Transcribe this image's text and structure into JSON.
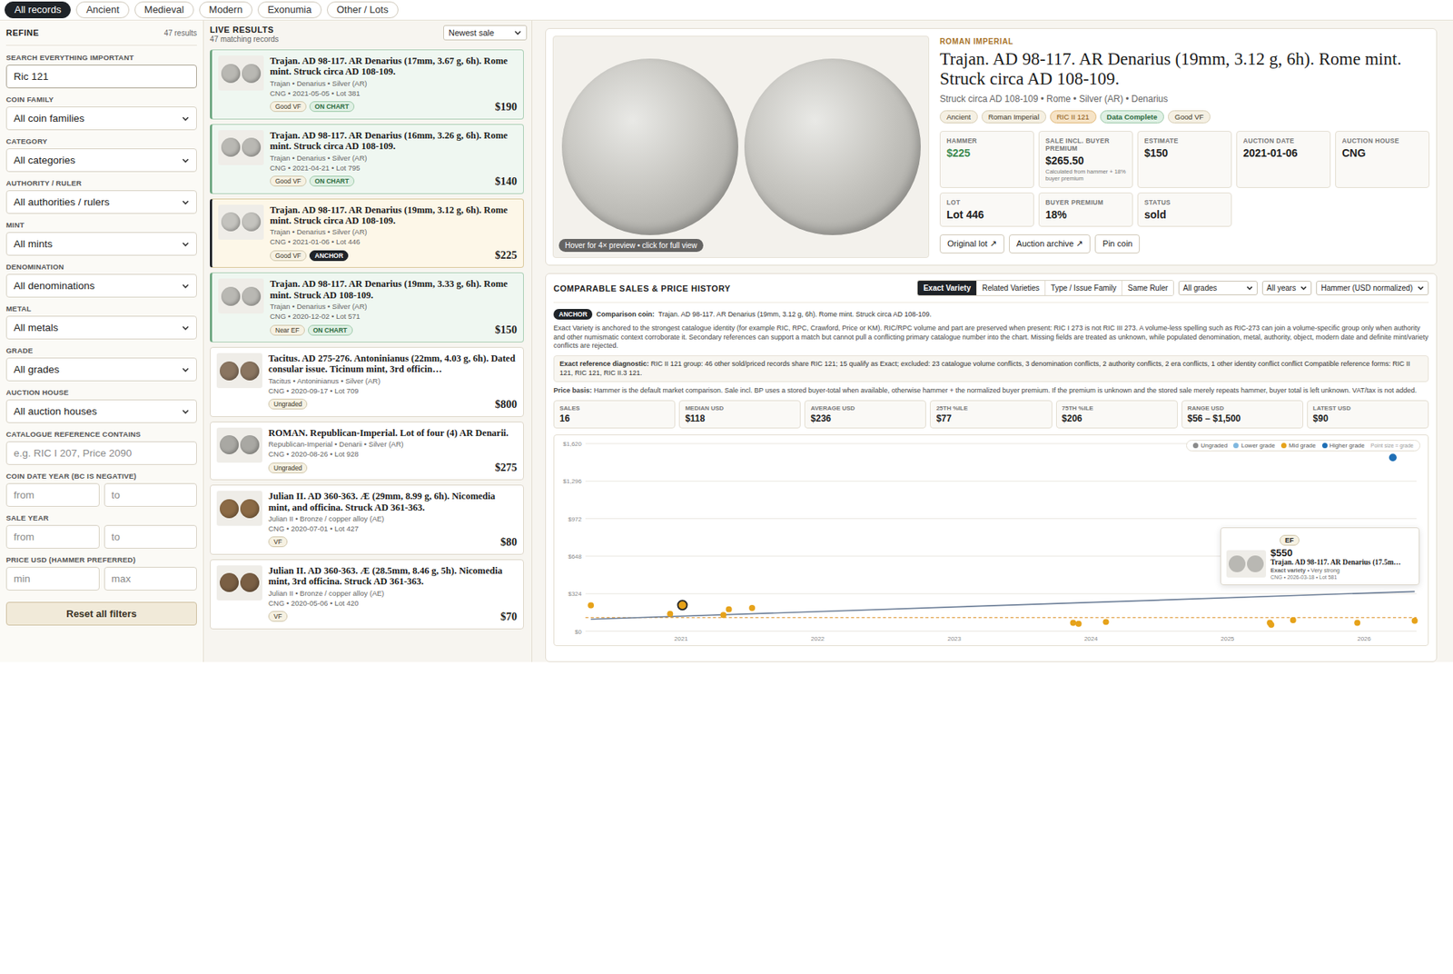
{
  "category_tabs": [
    {
      "label": "All records",
      "selected": true
    },
    {
      "label": "Ancient",
      "selected": false
    },
    {
      "label": "Medieval",
      "selected": false
    },
    {
      "label": "Modern",
      "selected": false
    },
    {
      "label": "Exonumia",
      "selected": false
    },
    {
      "label": "Other / Lots",
      "selected": false
    }
  ],
  "filters": {
    "title": "REFINE",
    "count": "47 results",
    "fields": [
      {
        "label": "SEARCH EVERYTHING IMPORTANT",
        "kind": "input",
        "value": "Ric 121"
      },
      {
        "label": "COIN FAMILY",
        "kind": "select",
        "value": "All coin families"
      },
      {
        "label": "CATEGORY",
        "kind": "select",
        "value": "All categories"
      },
      {
        "label": "AUTHORITY / RULER",
        "kind": "select",
        "value": "All authorities / rulers"
      },
      {
        "label": "MINT",
        "kind": "select",
        "value": "All mints"
      },
      {
        "label": "DENOMINATION",
        "kind": "select",
        "value": "All denominations"
      },
      {
        "label": "METAL",
        "kind": "select",
        "value": "All metals"
      },
      {
        "label": "GRADE",
        "kind": "select",
        "value": "All grades"
      },
      {
        "label": "AUCTION HOUSE",
        "kind": "select",
        "value": "All auction houses"
      },
      {
        "label": "CATALOGUE REFERENCE CONTAINS",
        "kind": "input",
        "placeholder": "e.g. RIC I 207, Price 2090"
      },
      {
        "label": "COIN DATE YEAR (BC IS NEGATIVE)",
        "kind": "range",
        "placeholders": [
          "from",
          "to"
        ]
      },
      {
        "label": "SALE YEAR",
        "kind": "range",
        "placeholders": [
          "from",
          "to"
        ]
      },
      {
        "label": "PRICE USD (HAMMER PREFERRED)",
        "kind": "range",
        "placeholders": [
          "min",
          "max"
        ]
      }
    ],
    "reset_button": "Reset all filters"
  },
  "results": {
    "title": "LIVE RESULTS",
    "count": "47 matching records",
    "sort": "Newest sale",
    "cards": [
      {
        "title": "Trajan. AD 98-117. AR Denarius (17mm, 3.67 g, 6h). Rome mint. Struck circa AD 108-109.",
        "meta": "Trajan • Denarius • Silver (AR)",
        "sale": "CNG • 2021-05-05 • Lot 381",
        "grade": "Good VF",
        "badge": "ON CHART",
        "price": "$190",
        "kind": "on-chart",
        "selected": false,
        "color": "#b9b8b3"
      },
      {
        "title": "Trajan. AD 98-117. AR Denarius (16mm, 3.26 g, 6h). Rome mint. Struck circa AD 108-109.",
        "meta": "Trajan • Denarius • Silver (AR)",
        "sale": "CNG • 2021-04-21 • Lot 795",
        "grade": "Good VF",
        "badge": "ON CHART",
        "price": "$140",
        "kind": "on-chart",
        "selected": false,
        "color": "#b9b8b3"
      },
      {
        "title": "Trajan. AD 98-117. AR Denarius (19mm, 3.12 g, 6h). Rome mint. Struck circa AD 108-109.",
        "meta": "Trajan • Denarius • Silver (AR)",
        "sale": "CNG • 2021-01-06 • Lot 446",
        "grade": "Good VF",
        "badge": "ANCHOR",
        "price": "$225",
        "kind": "anchor",
        "selected": true,
        "color": "#c4c3be"
      },
      {
        "title": "Trajan. AD 98-117. AR Denarius (19mm, 3.33 g, 6h). Rome mint. Struck AD 108-109.",
        "meta": "Trajan • Denarius • Silver (AR)",
        "sale": "CNG • 2020-12-02 • Lot 571",
        "grade": "Near EF",
        "badge": "ON CHART",
        "price": "$150",
        "kind": "on-chart",
        "selected": false,
        "color": "#b9b8b3"
      },
      {
        "title": "Tacitus. AD 275-276. Antoninianus (22mm, 4.03 g, 6h). Dated consular issue. Ticinum mint, 3rd officin…",
        "meta": "Tacitus • Antoninianus • Silver (AR)",
        "sale": "CNG • 2020-09-17 • Lot 709",
        "grade": "Ungraded",
        "price": "$800",
        "kind": "plain",
        "selected": false,
        "color": "#8a7560"
      },
      {
        "title": "ROMAN. Republican-Imperial. Lot of four (4) AR Denarii.",
        "meta": "Republican-Imperial • Denarii • Silver (AR)",
        "sale": "CNG • 2020-08-26 • Lot 928",
        "grade": "Ungraded",
        "price": "$275",
        "kind": "plain",
        "selected": false,
        "color": "#a9a8a3"
      },
      {
        "title": "Julian II. AD 360-363. Æ (29mm, 8.99 g, 6h). Nicomedia mint, and officina. Struck AD 361-363.",
        "meta": "Julian II • Bronze / copper alloy (AE)",
        "sale": "CNG • 2020-07-01 • Lot 427",
        "grade": "VF",
        "price": "$80",
        "kind": "plain",
        "selected": false,
        "color": "#8b6a45"
      },
      {
        "title": "Julian II. AD 360-363. Æ (28.5mm, 8.46 g, 5h). Nicomedia mint, 3rd officina. Struck AD 361-363.",
        "meta": "Julian II • Bronze / copper alloy (AE)",
        "sale": "CNG • 2020-05-06 • Lot 420",
        "grade": "VF",
        "price": "$70",
        "kind": "plain",
        "selected": false,
        "color": "#7a5f44"
      }
    ]
  },
  "detail": {
    "category": "ROMAN IMPERIAL",
    "title": "Trajan. AD 98-117. AR Denarius (19mm, 3.12 g, 6h). Rome mint. Struck circa AD 108-109.",
    "subtitle": "Struck circa AD 108-109 • Rome • Silver (AR) • Denarius",
    "image_hint": "Hover for 4× preview • click for full view",
    "tags": [
      {
        "label": "Ancient",
        "kind": "plain"
      },
      {
        "label": "Roman Imperial",
        "kind": "plain"
      },
      {
        "label": "RIC II 121",
        "kind": "reference"
      },
      {
        "label": "Data Complete",
        "kind": "complete"
      },
      {
        "label": "Good VF",
        "kind": "plain"
      }
    ],
    "stats": [
      {
        "label": "HAMMER",
        "value": "$225",
        "kind": "hammer"
      },
      {
        "label": "SALE INCL. BUYER PREMIUM",
        "value": "$265.50",
        "note": "Calculated from hammer + 18% buyer premium",
        "kind": "plain"
      },
      {
        "label": "ESTIMATE",
        "value": "$150",
        "kind": "plain"
      },
      {
        "label": "AUCTION DATE",
        "value": "2021-01-06",
        "kind": "plain"
      },
      {
        "label": "AUCTION HOUSE",
        "value": "CNG",
        "kind": "plain"
      },
      {
        "label": "LOT",
        "value": "Lot 446",
        "kind": "plain"
      },
      {
        "label": "BUYER PREMIUM",
        "value": "18%",
        "kind": "plain"
      },
      {
        "label": "STATUS",
        "value": "sold",
        "kind": "plain"
      }
    ],
    "buttons": [
      "Original lot ↗",
      "Auction archive ↗",
      "Pin coin"
    ]
  },
  "comparables": {
    "title": "COMPARABLE SALES & PRICE HISTORY",
    "modes": [
      {
        "label": "Exact Variety",
        "selected": true
      },
      {
        "label": "Related Varieties",
        "selected": false
      },
      {
        "label": "Type / Issue Family",
        "selected": false
      },
      {
        "label": "Same Ruler",
        "selected": false
      }
    ],
    "selects": [
      "All grades",
      "All years",
      "Hammer (USD normalized)"
    ],
    "anchor_badge": "ANCHOR",
    "comparison_label": "Comparison coin:",
    "comparison_coin": "Trajan. AD 98-117. AR Denarius (19mm, 3.12 g, 6h). Rome mint. Struck circa AD 108-109.",
    "explanation": "Exact Variety is anchored to the strongest catalogue identity (for example RIC, RPC, Crawford, Price or KM). RIC/RPC volume and part are preserved when present: RIC I 273 is not RIC III 273. A volume-less spelling such as RIC-273 can join a volume-specific group only when authority and other numismatic context corroborate it. Secondary references can support a match but cannot pull a conflicting primary catalogue number into the chart. Missing fields are treated as unknown, while populated denomination, metal, authority, object, modern date and definite mint/variety conflicts are rejected.",
    "diagnostic_label": "Exact reference diagnostic:",
    "diagnostic": "RIC II 121 group: 46 other sold/priced records share RIC 121; 15 qualify as Exact; excluded: 23 catalogue volume conflicts, 3 denomination conflicts, 2 authority conflicts, 2 era conflicts, 1 other identity conflict conflict Compatible reference forms: RIC II 121, RIC 121, RIC II.3 121.",
    "price_basis_label": "Price basis:",
    "price_basis": "Hammer is the default market comparison. Sale incl. BP uses a stored buyer-total when available, otherwise hammer + the normalized buyer premium. If the premium is unknown and the stored sale merely repeats hammer, buyer total is left unknown. VAT/tax is not added.",
    "stats": [
      {
        "label": "SALES",
        "value": "16"
      },
      {
        "label": "MEDIAN USD",
        "value": "$118"
      },
      {
        "label": "AVERAGE USD",
        "value": "$236"
      },
      {
        "label": "25TH %ILE",
        "value": "$77"
      },
      {
        "label": "75TH %ILE",
        "value": "$206"
      },
      {
        "label": "RANGE USD",
        "value": "$56 – $1,500"
      },
      {
        "label": "LATEST USD",
        "value": "$90"
      }
    ],
    "chart": {
      "y_max": 1620,
      "y_ticks": [
        "$1,620",
        "$1,296",
        "$972",
        "$648",
        "$324",
        "$0"
      ],
      "x_ticks": [
        "2021",
        "2022",
        "2023",
        "2024",
        "2025",
        "2026"
      ],
      "legend": [
        {
          "label": "Ungraded",
          "color": "#8a8a8a"
        },
        {
          "label": "Lower grade",
          "color": "#7fb7df"
        },
        {
          "label": "Mid grade",
          "color": "#e6a21a"
        },
        {
          "label": "Higher grade",
          "color": "#1f6fb5"
        }
      ],
      "legend_note": "Point size = grade",
      "series": [
        {
          "kind": "mid",
          "color": "#e6a21a",
          "dates": [
            2020.34,
            2020.92,
            2021.31,
            2021.35,
            2021.52,
            2023.87,
            2023.91,
            2024.11,
            2025.31,
            2025.32,
            2025.48,
            2025.95,
            2026.37
          ],
          "values": [
            223,
            150,
            140,
            190,
            200,
            72,
            64,
            80,
            72,
            56,
            96,
            72,
            90
          ]
        },
        {
          "kind": "higher",
          "color": "#1f6fb5",
          "dates": [
            2026.21,
            2026.21
          ],
          "values": [
            1500,
            550
          ]
        }
      ],
      "anchor": {
        "date": 2021.01,
        "value": 225,
        "color": "#e6a21a"
      },
      "trend": {
        "dates": [
          2020.34,
          2026.37
        ],
        "values": [
          104,
          343
        ]
      },
      "median": 118,
      "tooltip": {
        "grade": "EF",
        "price": "$550",
        "title": "Trajan. AD 98-117. AR Denarius (17.5m…",
        "match_label": "Exact variety",
        "match_strength": "• Very strong",
        "sale": "CNG • 2026-03-18 • Lot 581"
      }
    }
  }
}
